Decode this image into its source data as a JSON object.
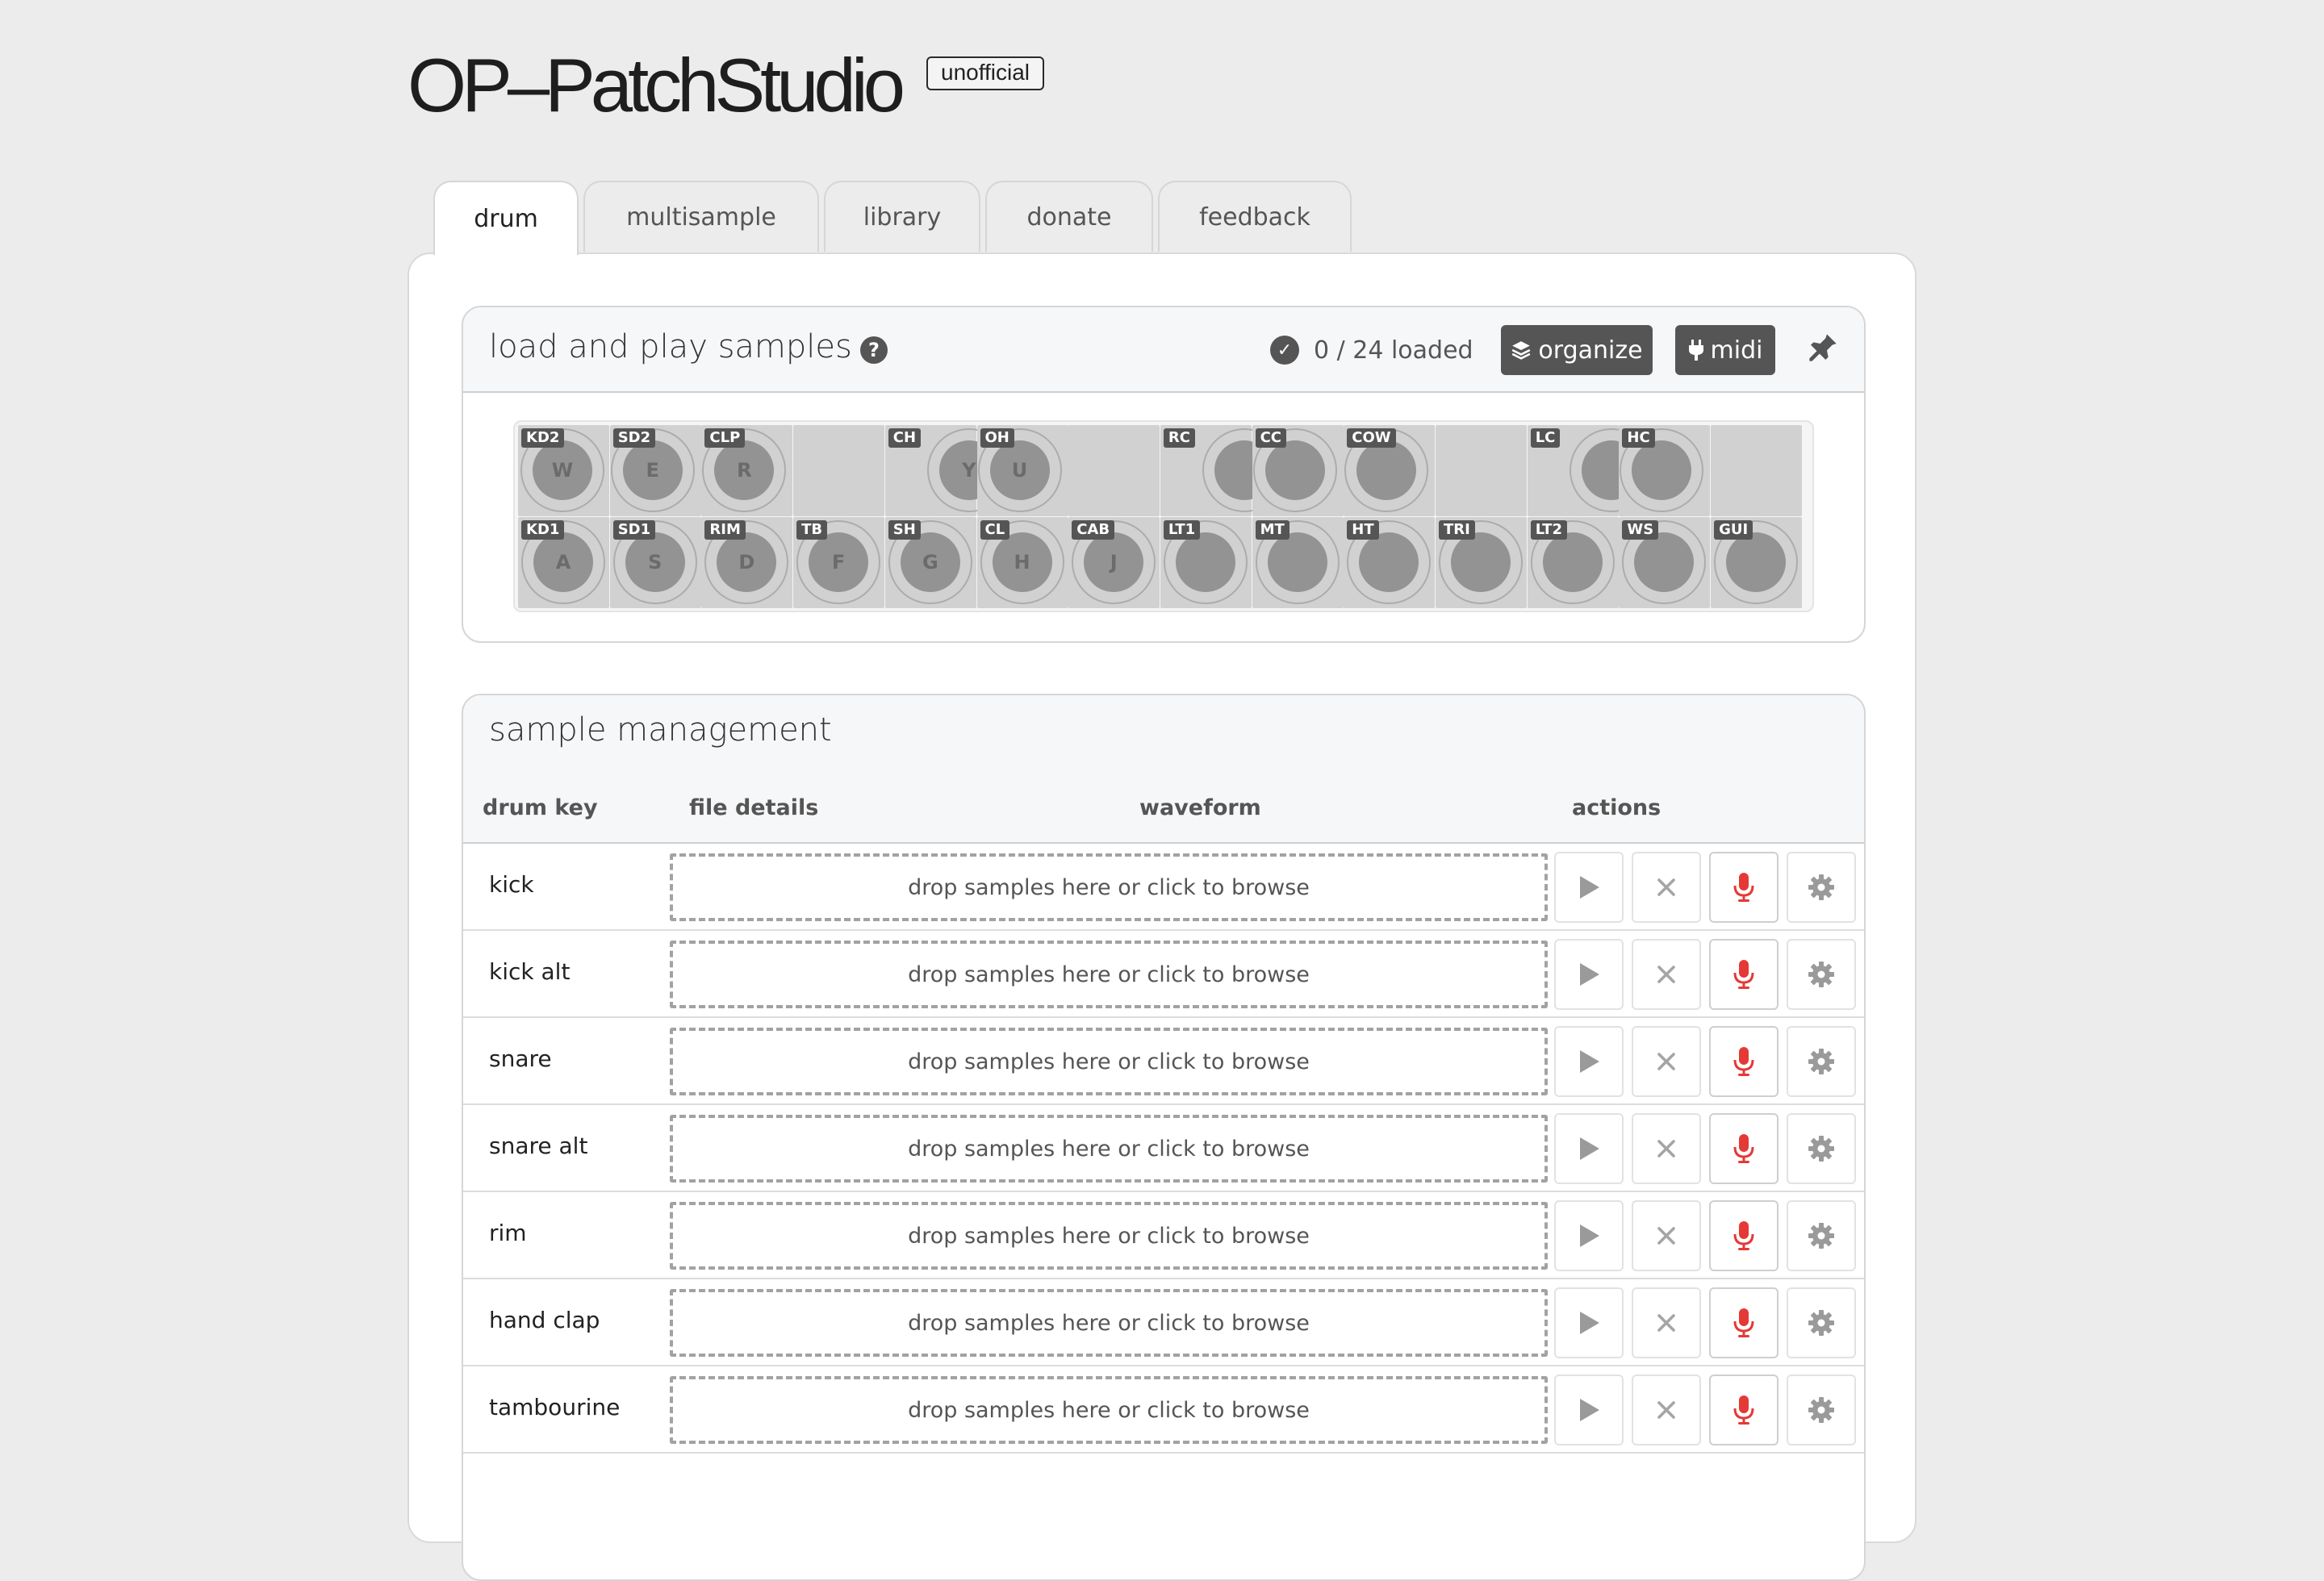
{
  "app": {
    "title": "OP–PatchStudio",
    "badge": "unofficial"
  },
  "tabs": [
    {
      "label": "drum",
      "active": true
    },
    {
      "label": "multisample",
      "active": false
    },
    {
      "label": "library",
      "active": false
    },
    {
      "label": "donate",
      "active": false
    },
    {
      "label": "feedback",
      "active": false
    }
  ],
  "load_section": {
    "title": "load and play samples",
    "help_icon": "question-circle-icon",
    "status": "0 / 24 loaded",
    "organize_label": "organize",
    "midi_label": "midi",
    "pin_icon": "pin-icon"
  },
  "pads": {
    "top": [
      {
        "tag": "KD2",
        "key": "W"
      },
      {
        "tag": "SD2",
        "key": "E"
      },
      {
        "tag": "CLP",
        "key": "R"
      },
      {
        "tag": "CH",
        "key": "Y"
      },
      {
        "tag": "OH",
        "key": "U"
      },
      {
        "tag": "RC",
        "key": ""
      },
      {
        "tag": "CC",
        "key": ""
      },
      {
        "tag": "COW",
        "key": ""
      },
      {
        "tag": "LC",
        "key": ""
      },
      {
        "tag": "HC",
        "key": ""
      }
    ],
    "bottom": [
      {
        "tag": "KD1",
        "key": "A"
      },
      {
        "tag": "SD1",
        "key": "S"
      },
      {
        "tag": "RIM",
        "key": "D"
      },
      {
        "tag": "TB",
        "key": "F"
      },
      {
        "tag": "SH",
        "key": "G"
      },
      {
        "tag": "CL",
        "key": "H"
      },
      {
        "tag": "CAB",
        "key": "J"
      },
      {
        "tag": "LT1",
        "key": ""
      },
      {
        "tag": "MT",
        "key": ""
      },
      {
        "tag": "HT",
        "key": ""
      },
      {
        "tag": "TRI",
        "key": ""
      },
      {
        "tag": "LT2",
        "key": ""
      },
      {
        "tag": "WS",
        "key": ""
      },
      {
        "tag": "GUI",
        "key": ""
      }
    ]
  },
  "management": {
    "title": "sample management",
    "columns": [
      "drum key",
      "file details",
      "waveform",
      "actions"
    ],
    "drop_text": "drop samples here or click to browse",
    "rows": [
      "kick",
      "kick alt",
      "snare",
      "snare alt",
      "rim",
      "hand clap",
      "tambourine"
    ]
  },
  "colors": {
    "accent_dark": "#555555",
    "record_red": "#e53935",
    "background": "#ececec"
  }
}
